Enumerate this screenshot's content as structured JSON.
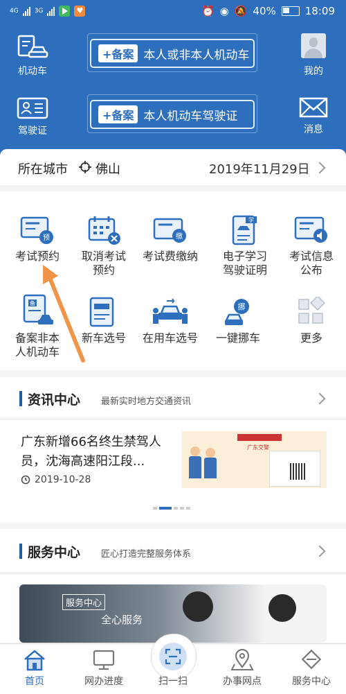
{
  "status_bar": {
    "net1": "4G",
    "net2": "3G",
    "battery": "40%",
    "time": "18:09"
  },
  "header": {
    "motor_label": "机动车",
    "license_label": "驾驶证",
    "mine_label": "我的",
    "message_label": "消息",
    "register_tag": "+备案",
    "register_vehicle": "本人或非本人机动车",
    "register_license": "本人机动车驾驶证"
  },
  "city": {
    "label": "所在城市",
    "name": "佛山",
    "date": "2019年11月29日"
  },
  "grid": [
    {
      "label": "考试预约"
    },
    {
      "label": "取消考试\n预约"
    },
    {
      "label": "考试费缴纳"
    },
    {
      "label": "电子学习\n驾驶证明"
    },
    {
      "label": "考试信息\n公布"
    },
    {
      "label": "备案非本\n人机动车"
    },
    {
      "label": "新车选号"
    },
    {
      "label": "在用车选号"
    },
    {
      "label": "一键挪车"
    },
    {
      "label": "更多"
    }
  ],
  "news": {
    "title": "资讯中心",
    "subtitle": "最新实时地方交通资讯",
    "headline": "广东新增66名终生禁驾人员，沈海高速阳江段...",
    "date": "2019-10-28",
    "thumb_text": "广东交警"
  },
  "service": {
    "title": "服务中心",
    "subtitle": "匠心打造完整服务体系",
    "banner_tag": "服务中心",
    "banner_text": "全心服务"
  },
  "tabs": [
    {
      "label": "首页"
    },
    {
      "label": "网办进度"
    },
    {
      "label": "扫一扫"
    },
    {
      "label": "办事网点"
    },
    {
      "label": "服务中心"
    }
  ],
  "colors": {
    "brand": "#2d6fbd",
    "arrow": "#f0944a"
  }
}
